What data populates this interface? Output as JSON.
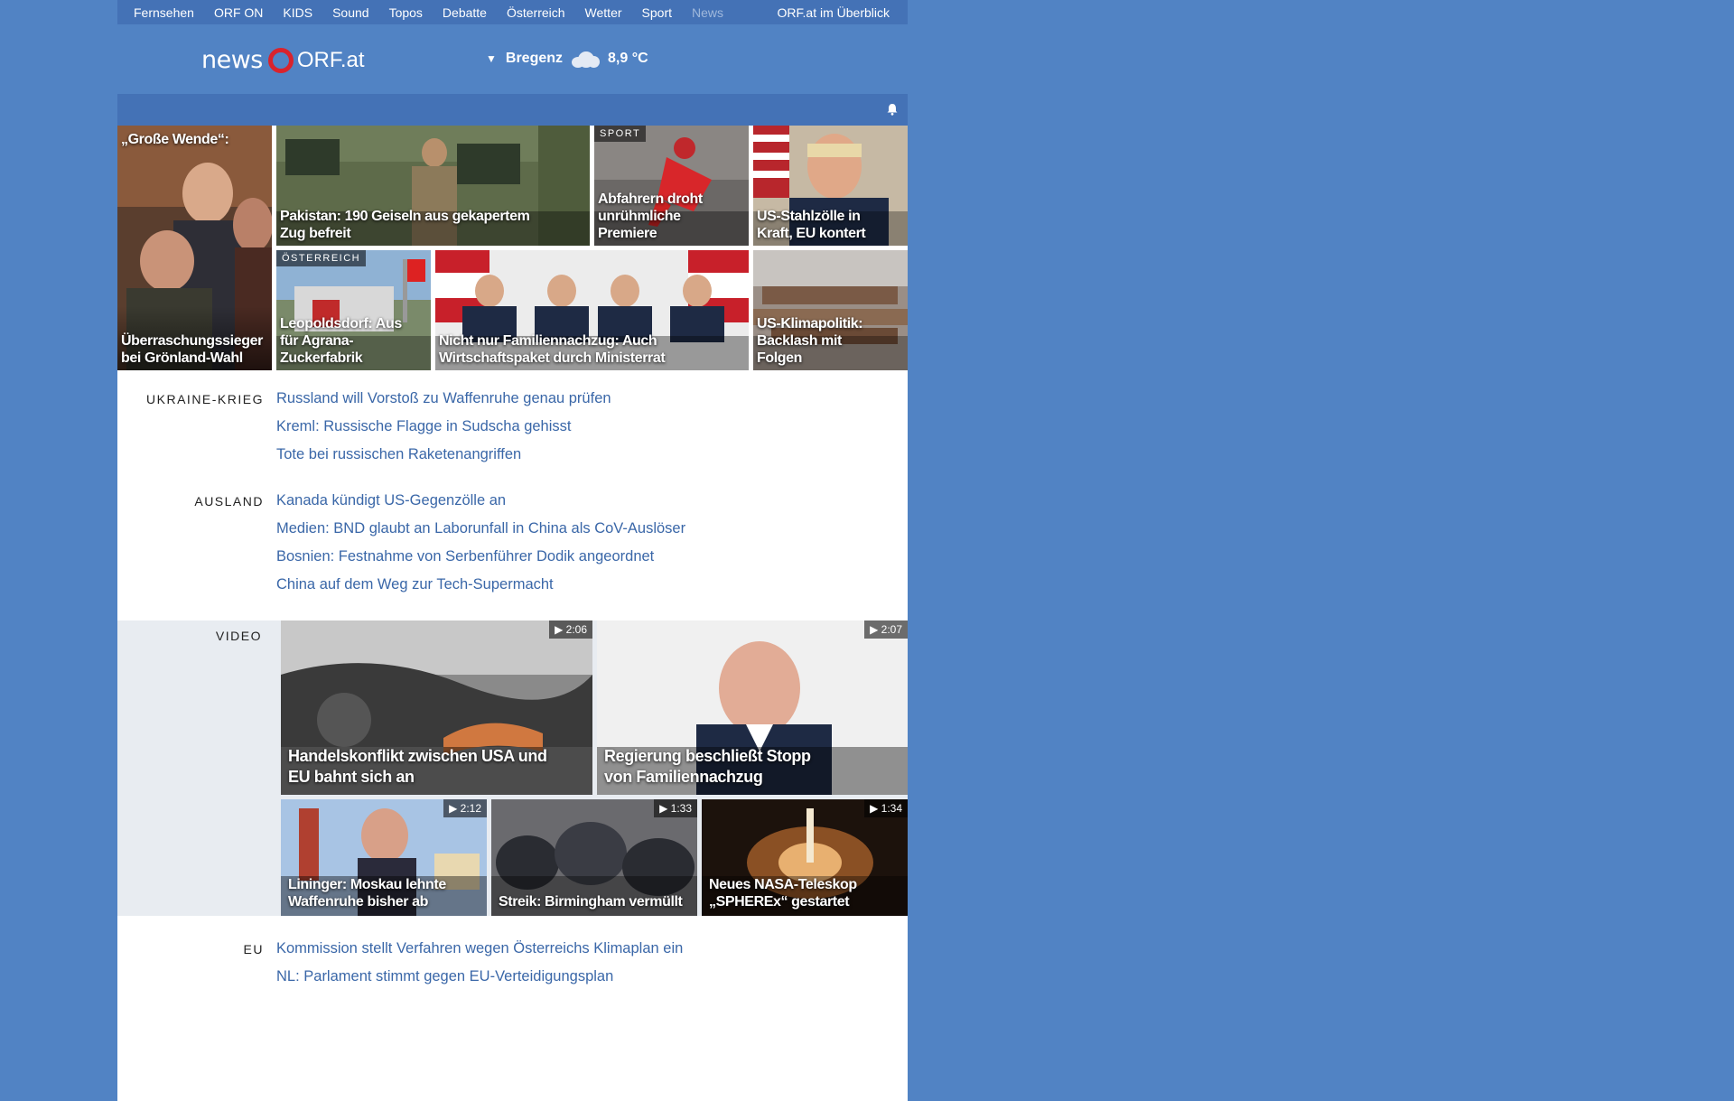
{
  "nav": {
    "items": [
      "Fernsehen",
      "ORF ON",
      "KIDS",
      "Sound",
      "Topos",
      "Debatte",
      "Österreich",
      "Wetter",
      "Sport",
      "News"
    ],
    "active": "News",
    "overview": "ORF.at im Überblick"
  },
  "header": {
    "logo_news": "news",
    "logo_orf": "ORF.at",
    "weather_city": "Bregenz",
    "weather_temp": "8,9 °C",
    "weather_icon": "cloud-icon"
  },
  "top_tiles": [
    {
      "caption": "„Große Wende“:",
      "caption2": "Überraschungssieger bei Grönland-Wahl",
      "tag": ""
    },
    {
      "caption": "Pakistan: 190 Geiseln aus gekapertem Zug befreit",
      "tag": ""
    },
    {
      "caption": "Abfahrern droht unrühmliche Premiere",
      "tag": "SPORT"
    },
    {
      "caption": "US-Stahlzölle in Kraft, EU kontert",
      "tag": ""
    },
    {
      "caption": "Leopoldsdorf: Aus für Agrana-Zuckerfabrik",
      "tag": "ÖSTERREICH"
    },
    {
      "caption": "Nicht nur Familiennachzug: Auch Wirtschaftspaket durch Ministerrat",
      "tag": ""
    },
    {
      "caption": "US-Klimapolitik: Backlash mit Folgen",
      "tag": ""
    }
  ],
  "sections": {
    "ukraine": {
      "label": "UKRAINE-KRIEG",
      "links": [
        "Russland will Vorstoß zu Waffenruhe genau prüfen",
        "Kreml: Russische Flagge in Sudscha gehisst",
        "Tote bei russischen Raketenangriffen"
      ]
    },
    "ausland": {
      "label": "AUSLAND",
      "links": [
        "Kanada kündigt US-Gegenzölle an",
        "Medien: BND glaubt an Laborunfall in China als CoV-Auslöser",
        "Bosnien: Festnahme von Serbenführer Dodik angeordnet",
        "China auf dem Weg zur Tech-Supermacht"
      ]
    },
    "eu": {
      "label": "EU",
      "links": [
        "Kommission stellt Verfahren wegen Österreichs Klimaplan ein",
        "NL: Parlament stimmt gegen EU-Verteidigungsplan"
      ]
    }
  },
  "video": {
    "label": "VIDEO",
    "items": [
      {
        "caption": "Handelskonflikt zwischen USA und EU bahnt sich an",
        "duration": "2:06"
      },
      {
        "caption": "Regierung beschließt Stopp von Familiennachzug",
        "duration": "2:07"
      },
      {
        "caption": "Lininger: Moskau lehnte Waffenruhe bisher ab",
        "duration": "2:12"
      },
      {
        "caption": "Streik: Birmingham vermüllt",
        "duration": "1:33"
      },
      {
        "caption": "Neues NASA-Teleskop „SPHEREx“ gestartet",
        "duration": "1:34"
      }
    ]
  },
  "colors": {
    "background": "#5183c4",
    "nav_bar": "#4472b6",
    "link": "#3a67a8",
    "orf_red": "#d9232d"
  }
}
